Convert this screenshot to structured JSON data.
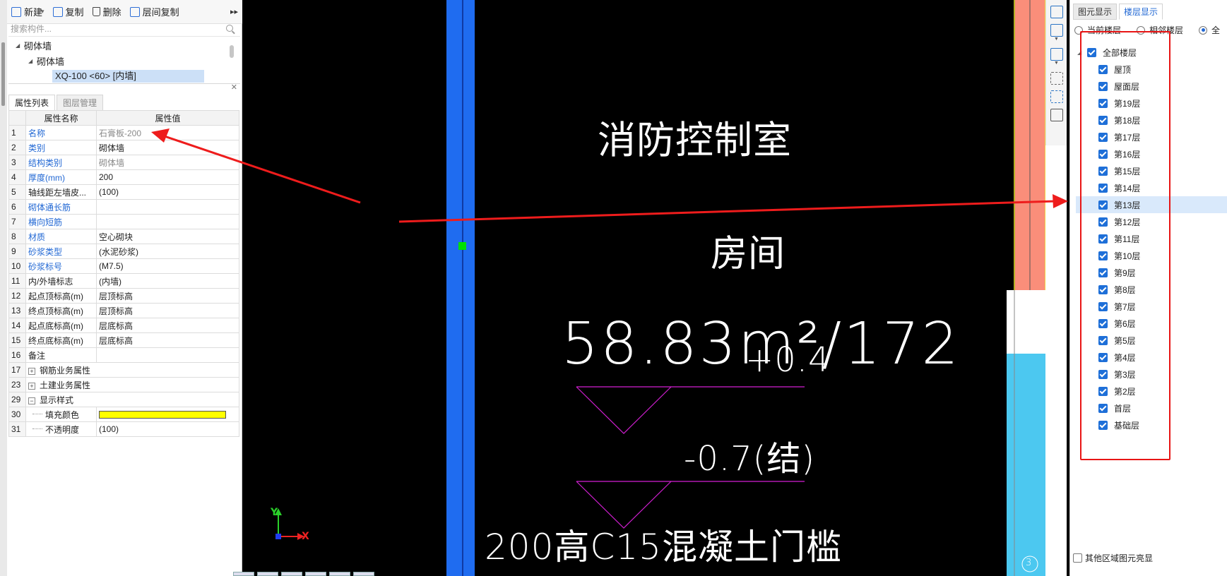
{
  "toolbar": {
    "new_label": "新建",
    "copy_label": "复制",
    "delete_label": "删除",
    "floor_copy_label": "层间复制",
    "more_label": "▸▸"
  },
  "search": {
    "placeholder": "搜索构件..."
  },
  "tree": {
    "root": "砌体墙",
    "child": "砌体墙",
    "selected_item": "XQ-100 <60> [内墙]"
  },
  "props_panel": {
    "tabs": [
      "属性列表",
      "图层管理"
    ],
    "col_name": "属性名称",
    "col_value": "属性值",
    "rows": [
      {
        "num": "1",
        "name": "名称",
        "value": "石膏板-200"
      },
      {
        "num": "2",
        "name": "类别",
        "value": "砌体墙"
      },
      {
        "num": "3",
        "name": "结构类别",
        "value": "砌体墙"
      },
      {
        "num": "4",
        "name": "厚度(mm)",
        "value": "200"
      },
      {
        "num": "5",
        "name": "轴线距左墙皮...",
        "value": "(100)"
      },
      {
        "num": "6",
        "name": "砌体通长筋",
        "value": ""
      },
      {
        "num": "7",
        "name": "横向短筋",
        "value": ""
      },
      {
        "num": "8",
        "name": "材质",
        "value": "空心砌块"
      },
      {
        "num": "9",
        "name": "砂浆类型",
        "value": "(水泥砂浆)"
      },
      {
        "num": "10",
        "name": "砂浆标号",
        "value": "(M7.5)"
      },
      {
        "num": "11",
        "name": "内/外墙标志",
        "value": "(内墙)"
      },
      {
        "num": "12",
        "name": "起点顶标高(m)",
        "value": "层顶标高"
      },
      {
        "num": "13",
        "name": "终点顶标高(m)",
        "value": "层顶标高"
      },
      {
        "num": "14",
        "name": "起点底标高(m)",
        "value": "层底标高"
      },
      {
        "num": "15",
        "name": "终点底标高(m)",
        "value": "层底标高"
      },
      {
        "num": "16",
        "name": "备注",
        "value": ""
      },
      {
        "num": "17",
        "name": "钢筋业务属性",
        "value": ""
      },
      {
        "num": "23",
        "name": "土建业务属性",
        "value": ""
      },
      {
        "num": "29",
        "name": "显示样式",
        "value": ""
      },
      {
        "num": "30",
        "name": "填充颜色",
        "value": ""
      },
      {
        "num": "31",
        "name": "不透明度",
        "value": "(100)"
      }
    ],
    "fill_color": "#ffff00"
  },
  "canvas": {
    "room_title": "消防控制室",
    "room_label": "房间",
    "area_text": "58.83m²/172",
    "elev_text_1": "+0.4",
    "elev_text_2": "-0.7(结)",
    "note_text": "200高C15混凝土门槛",
    "axis_x": "X",
    "axis_y": "Y",
    "grid_marker": "3",
    "colors": {
      "wall_blue": "#1f6cf0",
      "wall_salmon": "#fa8e7a",
      "wall_cyan": "#4cc8f0",
      "magenta": "#d21fd2",
      "arrow_red": "#ee1c1c"
    }
  },
  "right_panel": {
    "tabs": [
      "图元显示",
      "楼层显示"
    ],
    "radios": [
      {
        "label": "当前楼层",
        "checked": false
      },
      {
        "label": "相邻楼层",
        "checked": false
      },
      {
        "label": "全",
        "checked": true
      }
    ],
    "all_floors_label": "全部楼层",
    "floors": [
      "屋顶",
      "屋面层",
      "第19层",
      "第18层",
      "第17层",
      "第16层",
      "第15层",
      "第14层",
      "第13层",
      "第12层",
      "第11层",
      "第10层",
      "第9层",
      "第8层",
      "第7层",
      "第6层",
      "第5层",
      "第4层",
      "第3层",
      "第2层",
      "首层",
      "基础层"
    ],
    "highlighted_floor": "第13层",
    "bottom_checkbox_label": "其他区域图元亮显"
  }
}
